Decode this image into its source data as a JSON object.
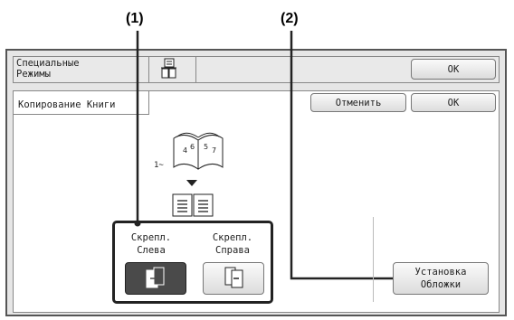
{
  "callouts": {
    "one": "(1)",
    "two": "(2)"
  },
  "header": {
    "title_line1": "Специальные",
    "title_line2": "Режимы",
    "ok_label": "OK",
    "mode_icon": "special-modes-icon"
  },
  "subheader": {
    "title": "Копирование Книги",
    "cancel_label": "Отменить",
    "ok_label": "OK"
  },
  "options": {
    "left": {
      "line1": "Скрепл.",
      "line2": "Слева",
      "icon": "left-binding-icon",
      "selected": true
    },
    "right": {
      "line1": "Скрепл.",
      "line2": "Справа",
      "icon": "right-binding-icon",
      "selected": false
    }
  },
  "illustration": {
    "page_label": "1~"
  },
  "cover_button": {
    "line1": "Установка",
    "line2": "Обложки"
  },
  "colors": {
    "selected": "#4a4a4a",
    "frame": "#555555",
    "panel": "#e6e6e6"
  }
}
